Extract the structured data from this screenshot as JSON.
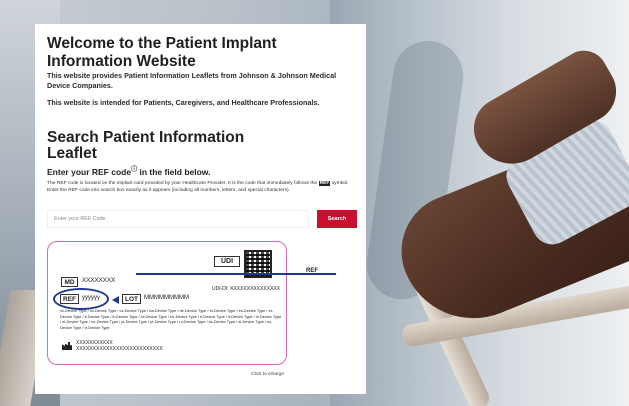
{
  "welcome": {
    "title": "Welcome to the Patient Implant Information Website",
    "line1": "This website provides Patient Information Leaflets from Johnson & Johnson Medical Device Companies.",
    "line2": "This website is intended for Patients, Caregivers, and Healthcare Professionals."
  },
  "search": {
    "title": "Search Patient Information Leaflet",
    "subtitle": "Enter your REF code",
    "subtitle_suffix": " in the field below.",
    "desc_part1": "The REF code is located on the implant card provided by your Healthcare Provider. It is the code that immediately follows the ",
    "desc_badge": "REF",
    "desc_part2": " symbol. Enter the REF code into search box exactly as it appears (including all numbers, letters, and special characters).",
    "placeholder": "Enter your REF Code",
    "button_label": "Search"
  },
  "card": {
    "udi_label": "UDI",
    "md_label": "MD",
    "md_value": "XXXXXXXX",
    "udi_di": "UDI-DI: XXXXXXXXXXXXXXX",
    "ref_label": "REF",
    "ref_value": "yyyyyy",
    "lot_label": "LOT",
    "lot_value": "MMMMMMMMM",
    "device_types": "xx-Device Type / xx-Device Type / cs-Device Type / da-Device Type / de-Device Type / el-Device Type / es-Device Type / et-Device Type / fi-Device Type / fr-Device Type / hr-Device Type / hu-Device Type / it-Device Type / lt-Device Type / lv-Device Type / nl-Device Type / no-Device Type / pl-Device Type / pt-Device Type / ro-Device Type / sk-Device Type / sl-Device Type / sv-Device Type / tr-Device Type",
    "mfr_line1": "XXXXXXXXXXX",
    "mfr_line2": "XXXXXXXXXXXXXXXXXXXXXXXXXX"
  },
  "enlarge_label": "Click to enlarge",
  "pointer_label": "REF",
  "colors": {
    "accent": "#c8102e",
    "card_border": "#d96ab3",
    "ref_highlight": "#1d3a8c"
  }
}
